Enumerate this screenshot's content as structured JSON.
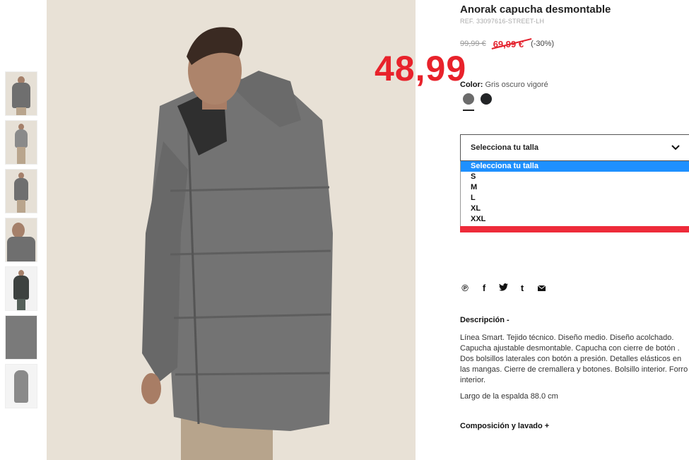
{
  "product": {
    "title": "Anorak capucha desmontable",
    "ref": "REF. 33097616-STREET-LH",
    "old_price": "99,99 €",
    "sale_price": "69,99 €",
    "discount": "(-30%)",
    "new_price_annotation": "48,99",
    "color_label": "Color:",
    "color_value": "Gris oscuro vigoré",
    "swatches": [
      {
        "name": "Gris oscuro vigoré",
        "color": "#6b6b6b"
      },
      {
        "name": "Negro",
        "color": "#222426"
      }
    ]
  },
  "size_select": {
    "selected": "Selecciona tu talla",
    "options": [
      "Selecciona tu talla",
      "S",
      "M",
      "L",
      "XL",
      "XXL"
    ]
  },
  "social": {
    "icons": [
      "pinterest-icon",
      "facebook-icon",
      "twitter-icon",
      "tumblr-icon",
      "mail-icon"
    ],
    "glyphs": [
      "℗",
      "f",
      "🐦",
      "t",
      "✉"
    ]
  },
  "description": {
    "title": "Descripción -",
    "text": "Línea Smart. Tejido técnico. Diseño medio. Diseño acolchado. Capucha ajustable desmontable. Capucha con cierre de botón . Dos bolsillos laterales con botón a presión. Detalles elásticos en las mangas. Cierre de cremallera y botones. Bolsillo interior. Forro interior.",
    "length": "Largo de la espalda 88.0 cm",
    "composition_title": "Composición y lavado +"
  },
  "colors": {
    "accent_red": "#e4222e",
    "select_highlight": "#1e90ff"
  }
}
